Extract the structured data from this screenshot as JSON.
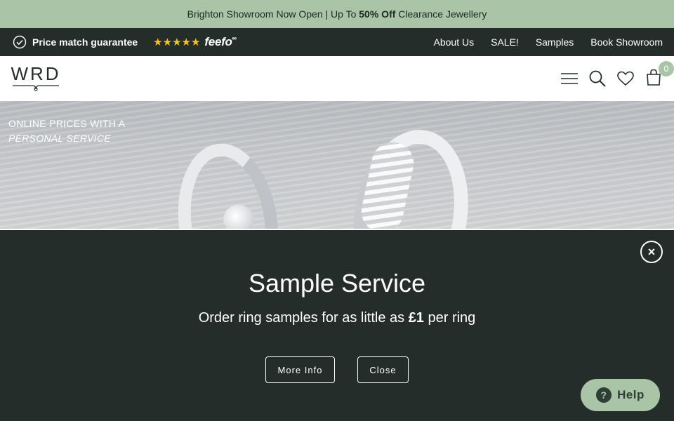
{
  "promo": {
    "text_before": "Brighton Showroom Now Open | Up To ",
    "bold": "50% Off",
    "text_after": " Clearance Jewellery"
  },
  "utility": {
    "guarantee": "Price match guarantee",
    "stars": "★★★★★",
    "feefo": "feefo",
    "links": [
      "About Us",
      "SALE!",
      "Samples",
      "Book Showroom"
    ]
  },
  "header": {
    "logo": "WRD",
    "bag_count": "0"
  },
  "hero": {
    "line1": "ONLINE PRICES WITH A",
    "line2": "PERSONAL SERVICE"
  },
  "popup": {
    "title": "Sample Service",
    "subtitle_before": "Order ring samples for as little as ",
    "subtitle_bold": "£1",
    "subtitle_after": " per ring",
    "more_info": "More Info",
    "close": "Close",
    "close_icon": "×"
  },
  "help": {
    "label": "Help",
    "icon": "?"
  },
  "colors": {
    "promo_bg": "#a9c4a6",
    "dark": "#242d29",
    "accent": "#a9c4a6",
    "stars": "#f5c518"
  }
}
